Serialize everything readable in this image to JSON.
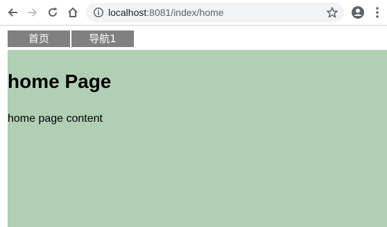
{
  "browser": {
    "url_host": "localhost",
    "url_rest": ":8081/index/home",
    "icons": {
      "back": "back-arrow-icon",
      "forward": "forward-arrow-icon",
      "reload": "reload-icon",
      "home": "home-icon",
      "info": "info-icon",
      "star": "star-icon",
      "profile": "profile-icon",
      "menu": "kebab-menu-icon"
    }
  },
  "page": {
    "menu": [
      {
        "label": "首页"
      },
      {
        "label": "导航1"
      }
    ],
    "heading": "home Page",
    "content": "home page content",
    "colors": {
      "menu_bg": "#808080",
      "menu_text": "#ffffff",
      "content_bg": "#b1cfb4"
    }
  }
}
